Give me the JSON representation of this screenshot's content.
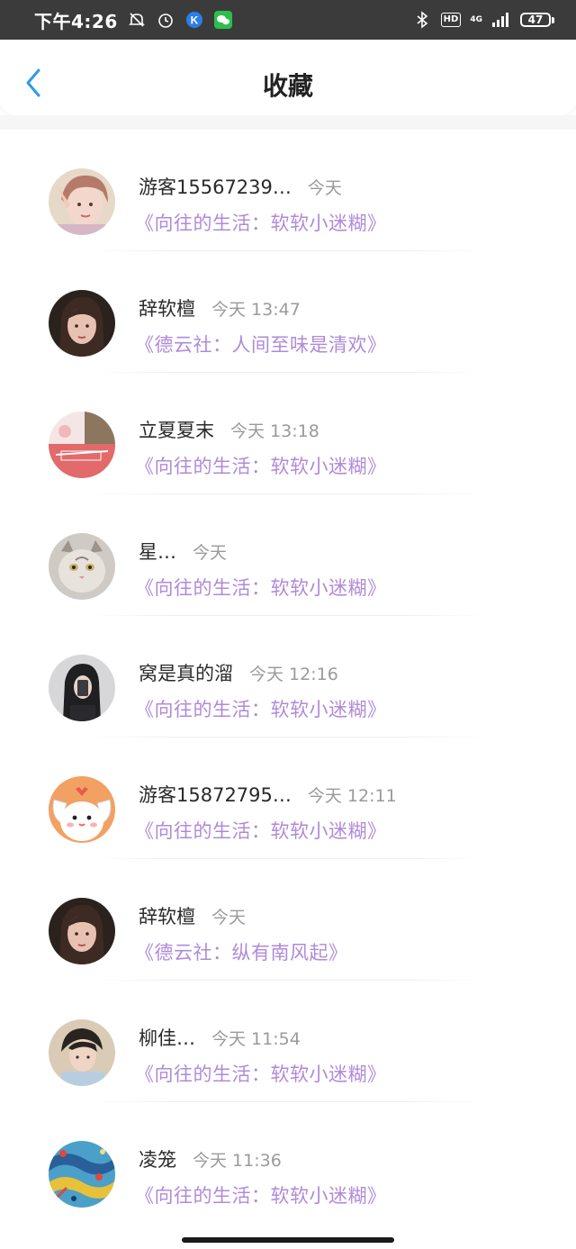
{
  "status_bar": {
    "time": "下午4:26",
    "network": "4G",
    "hd": "HD",
    "battery": "47"
  },
  "header": {
    "title": "收藏"
  },
  "items": [
    {
      "name": "游客15567239…",
      "time": "今天",
      "title": "《向往的生活：软软小迷糊》",
      "avatar": "avatar-girl-pink"
    },
    {
      "name": "辞软檀",
      "time": "今天 13:47",
      "title": "《德云社：人间至味是清欢》",
      "avatar": "avatar-girl-dark"
    },
    {
      "name": "立夏夏末",
      "time": "今天 13:18",
      "title": "《向往的生活：软软小迷糊》",
      "avatar": "avatar-red-art"
    },
    {
      "name": "星…",
      "time": "今天",
      "title": "《向往的生活：软软小迷糊》",
      "avatar": "avatar-cat"
    },
    {
      "name": "窝是真的溜",
      "time": "今天 12:16",
      "title": "《向往的生活：软软小迷糊》",
      "avatar": "avatar-mirror-selfie"
    },
    {
      "name": "游客15872795…",
      "time": "今天 12:11",
      "title": "《向往的生活：软软小迷糊》",
      "avatar": "avatar-cartoon-dog"
    },
    {
      "name": "辞软檀",
      "time": "今天",
      "title": "《德云社：纵有南风起》",
      "avatar": "avatar-girl-dark"
    },
    {
      "name": "柳佳…",
      "time": "今天 11:54",
      "title": "《向往的生活：软软小迷糊》",
      "avatar": "avatar-boy"
    },
    {
      "name": "凌笼",
      "time": "今天 11:36",
      "title": "《向往的生活：软软小迷糊》",
      "avatar": "avatar-colorful-pattern"
    }
  ],
  "colors": {
    "accent": "#2d9be8",
    "title_purple": "#b08ad8",
    "status_bar": "#3b3b3b"
  }
}
